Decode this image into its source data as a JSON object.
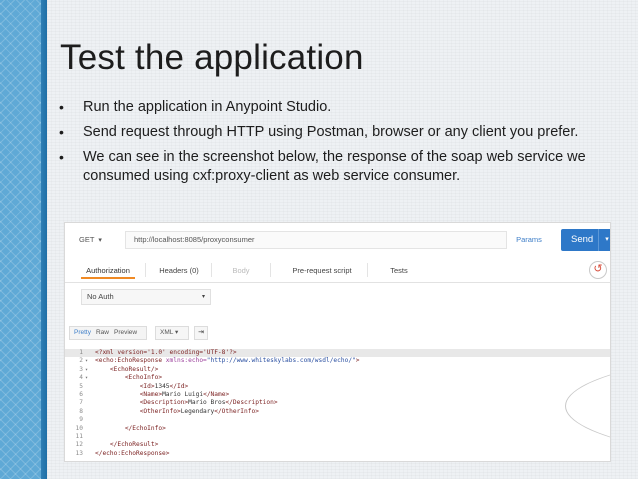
{
  "slide": {
    "title": "Test the application",
    "bullets": [
      "Run the application in Anypoint Studio.",
      "Send request through HTTP using Postman, browser or any client you prefer.",
      "We can see in the screenshot below, the response of the soap web service we consumed using cxf:proxy-client as web service consumer."
    ],
    "accent_color": "#5fa9d6"
  },
  "postman": {
    "method": "GET",
    "url": "http://localhost:8085/proxyconsumer",
    "params_label": "Params",
    "send_label": "Send",
    "send_color": "#2e78c8",
    "save_color": "#1fa67a",
    "tabs": [
      "Authorization",
      "Headers (0)",
      "Body",
      "Pre-request script",
      "Tests"
    ],
    "active_tab": "Authorization",
    "auth_type": "No Auth",
    "view_modes": [
      "Pretty",
      "Raw",
      "Preview"
    ],
    "language": "XML",
    "response_lines": [
      {
        "n": "1",
        "fold": "",
        "text": "<?xml version='1.0' encoding='UTF-8'?>"
      },
      {
        "n": "2",
        "fold": "▾",
        "text": "<echo:EchoResponse xmlns:echo=\"http://www.whiteskylabs.com/wsdl/echo/\">"
      },
      {
        "n": "3",
        "fold": "▾",
        "text": "    <EchoResult/>"
      },
      {
        "n": "4",
        "fold": "▾",
        "text": "        <EchoInfo>"
      },
      {
        "n": "5",
        "fold": "",
        "text": "            <Id>1345</Id>"
      },
      {
        "n": "6",
        "fold": "",
        "text": "            <Name>Mario Luigi</Name>"
      },
      {
        "n": "7",
        "fold": "",
        "text": "            <Description>Mario Bros</Description>"
      },
      {
        "n": "8",
        "fold": "",
        "text": "            <OtherInfo>Legendary</OtherInfo>"
      },
      {
        "n": "9",
        "fold": "",
        "text": ""
      },
      {
        "n": "10",
        "fold": "",
        "text": "        </EchoInfo>"
      },
      {
        "n": "11",
        "fold": "",
        "text": ""
      },
      {
        "n": "12",
        "fold": "",
        "text": "    </EchoResult>"
      },
      {
        "n": "13",
        "fold": "",
        "text": "</echo:EchoResponse>"
      }
    ]
  }
}
